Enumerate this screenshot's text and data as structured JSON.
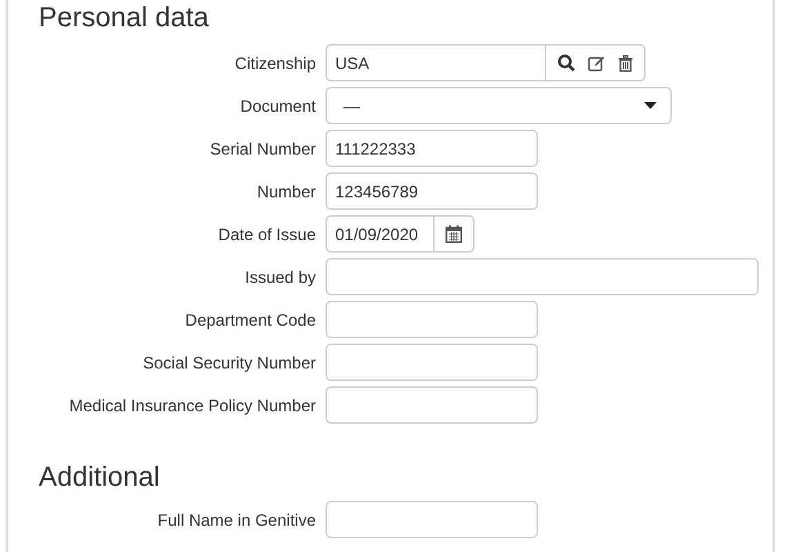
{
  "sections": [
    {
      "title": "Personal data",
      "fields": [
        {
          "kind": "lookup",
          "label": "Citizenship",
          "value": "USA"
        },
        {
          "kind": "select",
          "label": "Document",
          "value": "—"
        },
        {
          "kind": "text",
          "label": "Serial Number",
          "value": "111222333"
        },
        {
          "kind": "text",
          "label": "Number",
          "value": "123456789"
        },
        {
          "kind": "date",
          "label": "Date of Issue",
          "value": "01/09/2020"
        },
        {
          "kind": "wide",
          "label": "Issued by"
        },
        {
          "kind": "text",
          "label": "Department Code"
        },
        {
          "kind": "text",
          "label": "Social Security Number"
        },
        {
          "kind": "text",
          "label": "Medical Insurance Policy Number"
        }
      ]
    },
    {
      "title": "Additional",
      "fields": [
        {
          "kind": "text",
          "label": "Full Name in Genitive"
        }
      ]
    }
  ]
}
